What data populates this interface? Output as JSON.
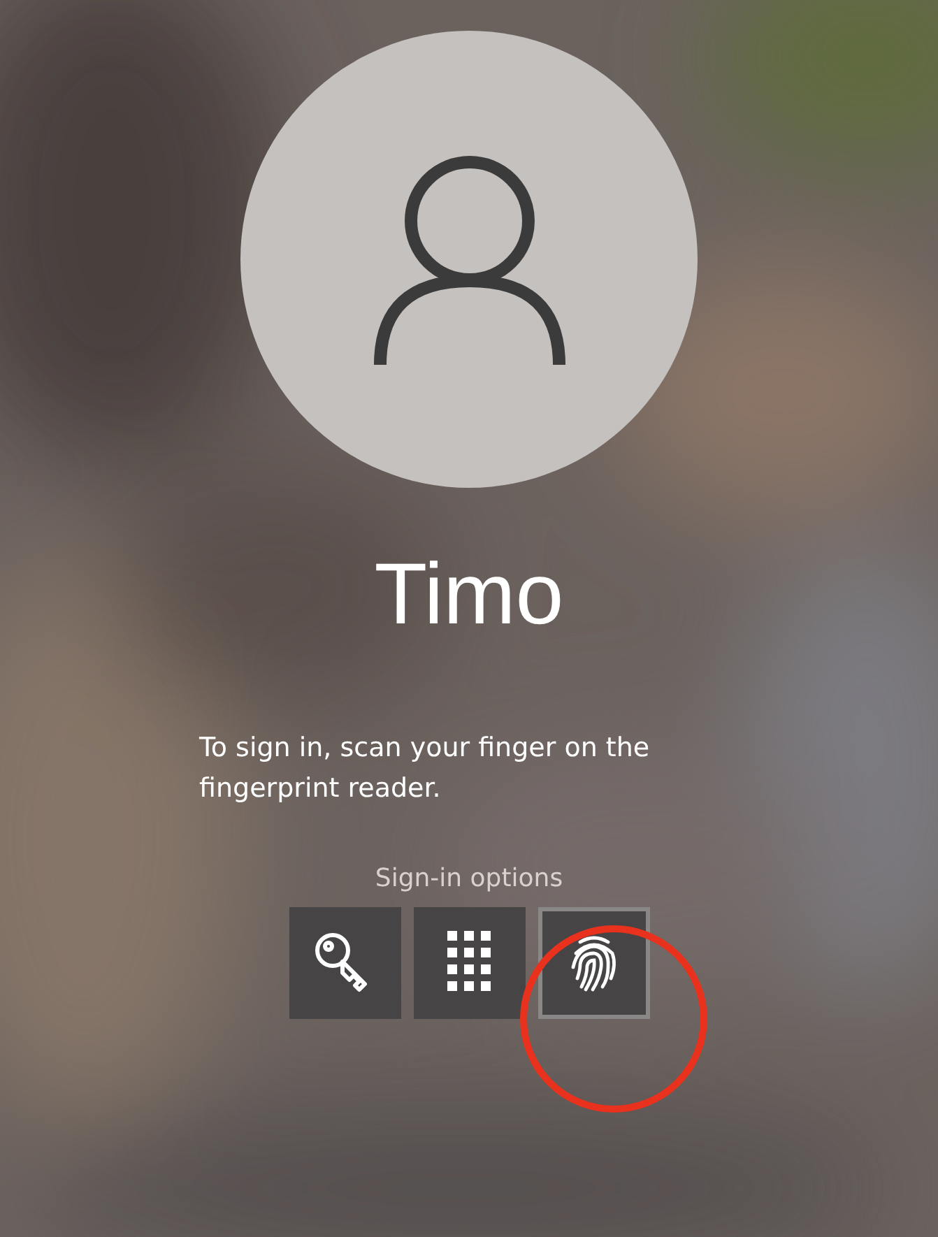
{
  "user": {
    "name": "Timo"
  },
  "message": "To sign in, scan your finger on the fingerprint reader.",
  "sign_in_options": {
    "label": "Sign-in options",
    "options": [
      {
        "kind": "key",
        "selected": false
      },
      {
        "kind": "pin",
        "selected": false
      },
      {
        "kind": "fingerprint",
        "selected": true
      }
    ]
  },
  "annotation": {
    "kind": "circle",
    "color": "#e8321e"
  }
}
